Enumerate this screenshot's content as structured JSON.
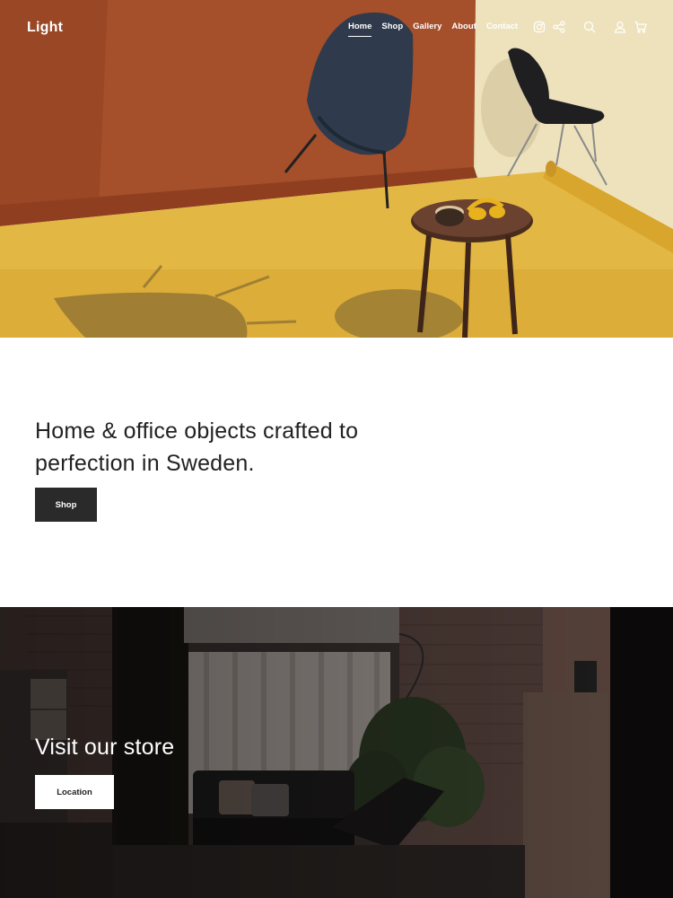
{
  "brand": {
    "name": "Light"
  },
  "nav": {
    "items": [
      {
        "label": "Home",
        "active": true
      },
      {
        "label": "Shop",
        "active": false
      },
      {
        "label": "Gallery",
        "active": false
      },
      {
        "label": "About",
        "active": false
      },
      {
        "label": "Contact",
        "active": false
      }
    ]
  },
  "header_icons": [
    "instagram-icon",
    "share-icon",
    "search-icon",
    "user-icon",
    "cart-icon"
  ],
  "hero": {
    "image": "chairs-and-side-table-photo"
  },
  "intro": {
    "headline": "Home & office objects crafted to perfection in Sweden.",
    "button_label": "Shop"
  },
  "store": {
    "title": "Visit our store",
    "button_label": "Location",
    "image": "store-interior-photo"
  },
  "colors": {
    "dark_button": "#2a2a2a",
    "hero_wall": "#a24e2a",
    "hero_floor": "#e3b642"
  }
}
